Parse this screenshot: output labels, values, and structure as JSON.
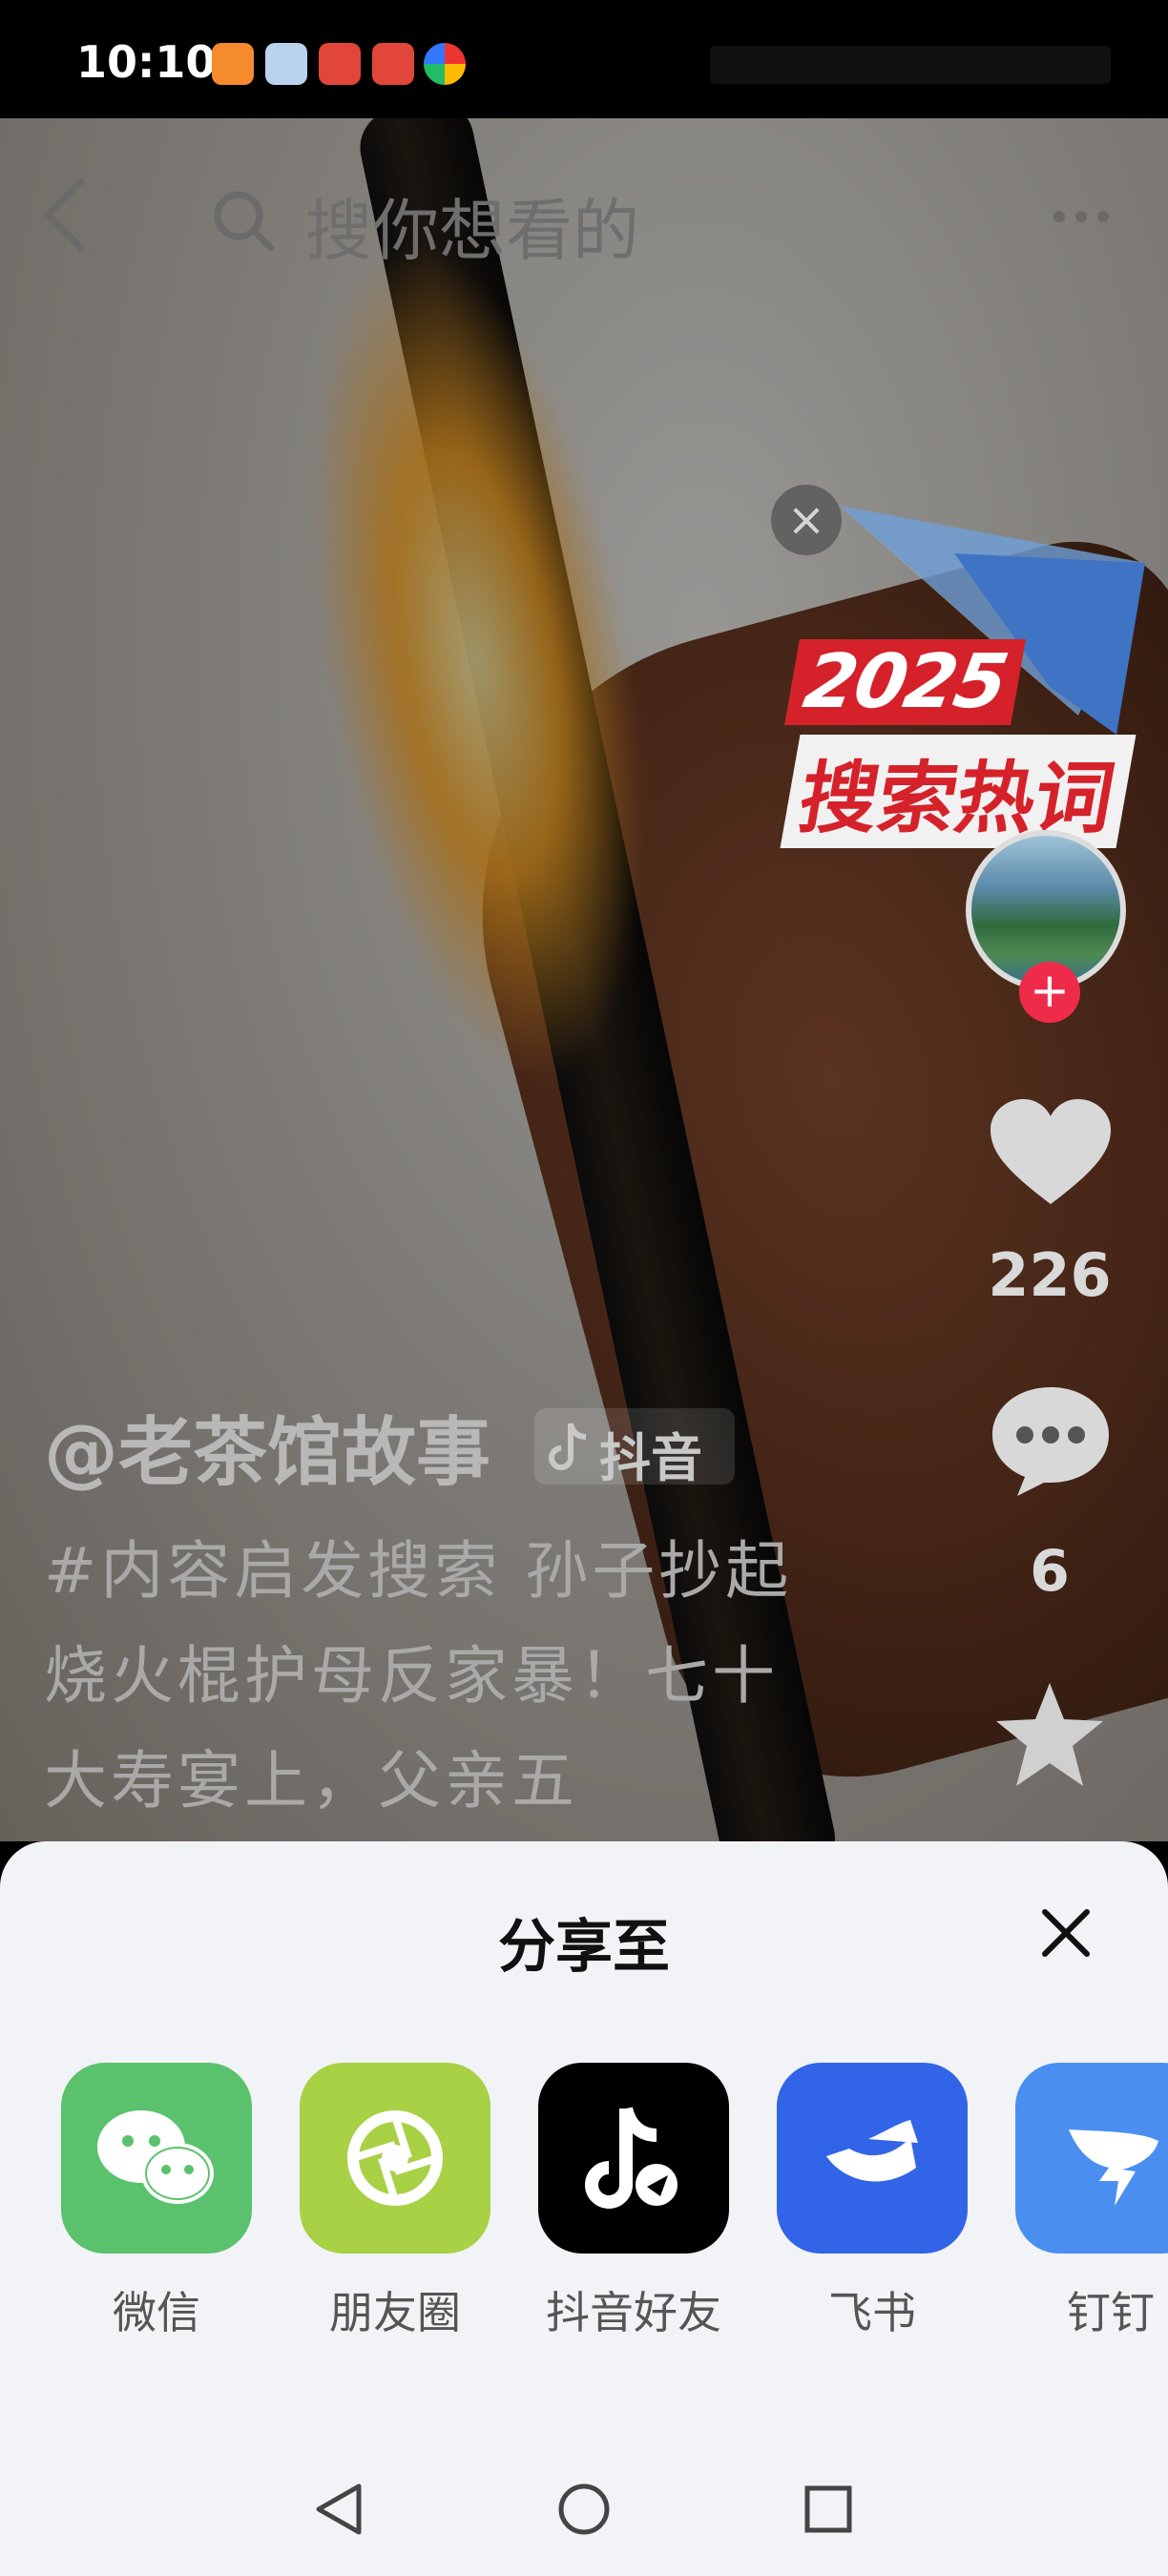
{
  "status_bar": {
    "time": "10:10",
    "app_icons": [
      "heart-app-icon",
      "photo-app-icon",
      "shopping-app-icon",
      "shopping-app-icon-2",
      "multicolor-app-icon"
    ]
  },
  "top_bar": {
    "search_placeholder": "搜你想看的"
  },
  "promo": {
    "year": "2025",
    "text": "搜索热词"
  },
  "actions": {
    "like_count": "226",
    "comment_count": "6"
  },
  "video_info": {
    "author": "@老茶馆故事",
    "platform": "抖音",
    "caption": "#内容启发搜索 孙子抄起烧火棍护母反家暴！七十大寿宴上，父亲五"
  },
  "share_sheet": {
    "title": "分享至",
    "items": [
      {
        "label": "微信",
        "color": "#5ac26d",
        "icon": "wechat-icon"
      },
      {
        "label": "朋友圈",
        "color": "#a8d146",
        "icon": "moments-icon"
      },
      {
        "label": "抖音好友",
        "color": "#000000",
        "icon": "douyin-friend-icon"
      },
      {
        "label": "飞书",
        "color": "#3264e8",
        "icon": "feishu-icon"
      },
      {
        "label": "钉钉",
        "color": "#4a8ff0",
        "icon": "dingtalk-icon"
      }
    ]
  },
  "nav_bar": {
    "buttons": [
      "back",
      "home",
      "recents"
    ]
  }
}
